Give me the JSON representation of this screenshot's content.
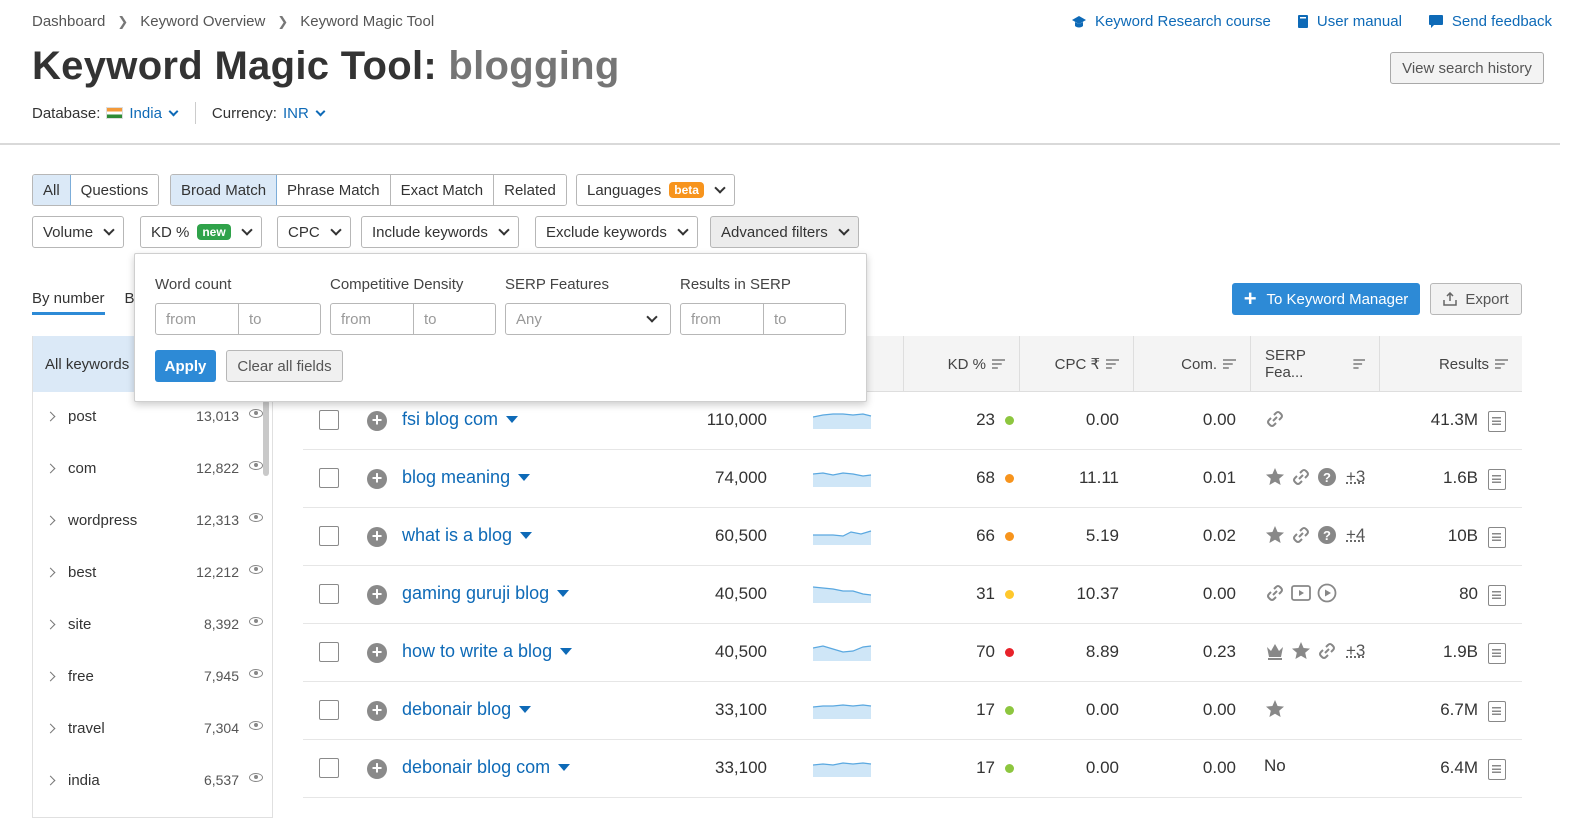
{
  "breadcrumb": [
    "Dashboard",
    "Keyword Overview",
    "Keyword Magic Tool"
  ],
  "toplinks": {
    "course": "Keyword Research course",
    "manual": "User manual",
    "feedback": "Send feedback"
  },
  "title": {
    "prefix": "Keyword Magic Tool:",
    "keyword": "blogging"
  },
  "history_button": "View search history",
  "database": {
    "label": "Database:",
    "value": "India"
  },
  "currency": {
    "label": "Currency:",
    "value": "INR"
  },
  "filters_row1": {
    "type_tabs": [
      "All",
      "Questions"
    ],
    "match_tabs": [
      "Broad Match",
      "Phrase Match",
      "Exact Match",
      "Related"
    ],
    "languages": "Languages",
    "languages_badge": "beta"
  },
  "filters_row2": {
    "volume": "Volume",
    "kd": "KD %",
    "kd_badge": "new",
    "cpc": "CPC",
    "include": "Include keywords",
    "exclude": "Exclude keywords",
    "advanced": "Advanced filters"
  },
  "popup": {
    "word_count": "Word count",
    "comp_density": "Competitive Density",
    "serp_features": "SERP Features",
    "results": "Results in SERP",
    "from": "from",
    "to": "to",
    "any": "Any",
    "apply": "Apply",
    "clear": "Clear all fields"
  },
  "tabs": {
    "by_number": "By number",
    "by_volume_partial": "B"
  },
  "actions": {
    "to_km": "To Keyword Manager",
    "export": "Export"
  },
  "sidebar": {
    "head": "All keywords",
    "items": [
      {
        "label": "post",
        "count": "13,013"
      },
      {
        "label": "com",
        "count": "12,822"
      },
      {
        "label": "wordpress",
        "count": "12,313"
      },
      {
        "label": "best",
        "count": "12,212"
      },
      {
        "label": "site",
        "count": "8,392"
      },
      {
        "label": "free",
        "count": "7,945"
      },
      {
        "label": "travel",
        "count": "7,304"
      },
      {
        "label": "india",
        "count": "6,537"
      }
    ]
  },
  "table": {
    "headers": {
      "kd": "KD %",
      "cpc": "CPC ₹",
      "com": "Com.",
      "serp": "SERP Fea...",
      "results": "Results"
    },
    "rows": [
      {
        "keyword": "fsi blog com",
        "volume": "110,000",
        "kd": "23",
        "kd_color": "#8dc63f",
        "cpc": "0.00",
        "com": "0.00",
        "serp": [
          "link-icon"
        ],
        "more": "",
        "results": "41.3M"
      },
      {
        "keyword": "blog meaning",
        "volume": "74,000",
        "kd": "68",
        "kd_color": "#f7941d",
        "cpc": "11.11",
        "com": "0.01",
        "serp": [
          "star-icon",
          "link-icon",
          "question-icon"
        ],
        "more": "+3",
        "results": "1.6B"
      },
      {
        "keyword": "what is a blog",
        "volume": "60,500",
        "kd": "66",
        "kd_color": "#f7941d",
        "cpc": "5.19",
        "com": "0.02",
        "serp": [
          "star-icon",
          "link-icon",
          "question-icon"
        ],
        "more": "+4",
        "results": "10B"
      },
      {
        "keyword": "gaming guruji blog",
        "volume": "40,500",
        "kd": "31",
        "kd_color": "#ffc82c",
        "cpc": "10.37",
        "com": "0.00",
        "serp": [
          "link-icon",
          "video-icon",
          "play-icon"
        ],
        "more": "",
        "results": "80"
      },
      {
        "keyword": "how to write a blog",
        "volume": "40,500",
        "kd": "70",
        "kd_color": "#e8222a",
        "cpc": "8.89",
        "com": "0.23",
        "serp": [
          "crown-icon",
          "star-icon",
          "link-icon"
        ],
        "more": "+3",
        "results": "1.9B"
      },
      {
        "keyword": "debonair blog",
        "volume": "33,100",
        "kd": "17",
        "kd_color": "#8dc63f",
        "cpc": "0.00",
        "com": "0.00",
        "serp": [
          "star-icon"
        ],
        "more": "",
        "results": "6.7M"
      },
      {
        "keyword": "debonair blog com",
        "volume": "33,100",
        "kd": "17",
        "kd_color": "#8dc63f",
        "cpc": "0.00",
        "com": "0.00",
        "serp_text": "No",
        "serp": [],
        "more": "",
        "results": "6.4M"
      }
    ]
  }
}
